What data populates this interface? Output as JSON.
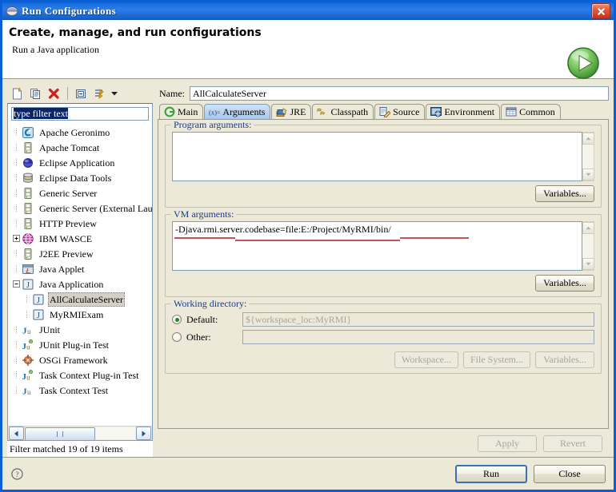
{
  "window": {
    "title": "Run Configurations",
    "title_icon": "run-config-icon",
    "close_label": "✕"
  },
  "header": {
    "heading": "Create, manage, and run configurations",
    "subtitle": "Run a Java application",
    "badge_icon": "green-run-play-icon"
  },
  "toolbar": {
    "items": [
      {
        "name": "new-launch-configuration",
        "icon": "new-document-icon"
      },
      {
        "name": "duplicate-launch-configuration",
        "icon": "copy-document-icon"
      },
      {
        "name": "delete-launch-configuration",
        "icon": "red-x-delete-icon"
      },
      {
        "name": "collapse-all",
        "icon": "collapse-all-icon"
      },
      {
        "name": "filter-launch-configurations",
        "icon": "filter-icon"
      },
      {
        "name": "filter-menu-arrow",
        "icon": "chevron-down-icon"
      }
    ]
  },
  "filter": {
    "value": "type filter text",
    "placeholder": "type filter text",
    "status": "Filter matched 19 of 19 items"
  },
  "tree": {
    "items": [
      {
        "label": "Apache Geronimo",
        "icon": "apache-geronimo-icon",
        "indent": 1,
        "expander": "none",
        "selected": false
      },
      {
        "label": "Apache Tomcat",
        "icon": "server-icon",
        "indent": 1,
        "expander": "none",
        "selected": false
      },
      {
        "label": "Eclipse Application",
        "icon": "eclipse-sphere-icon",
        "indent": 1,
        "expander": "none",
        "selected": false
      },
      {
        "label": "Eclipse Data Tools",
        "icon": "database-icon",
        "indent": 1,
        "expander": "none",
        "selected": false
      },
      {
        "label": "Generic Server",
        "icon": "server-icon",
        "indent": 1,
        "expander": "none",
        "selected": false
      },
      {
        "label": "Generic Server (External Launch)",
        "icon": "server-icon",
        "indent": 1,
        "expander": "none",
        "selected": false
      },
      {
        "label": "HTTP Preview",
        "icon": "server-icon",
        "indent": 1,
        "expander": "none",
        "selected": false
      },
      {
        "label": "IBM WASCE",
        "icon": "wasce-globe-icon",
        "indent": 1,
        "expander": "plus",
        "selected": false
      },
      {
        "label": "J2EE Preview",
        "icon": "server-icon",
        "indent": 1,
        "expander": "none",
        "selected": false
      },
      {
        "label": "Java Applet",
        "icon": "java-applet-icon",
        "indent": 1,
        "expander": "none",
        "selected": false
      },
      {
        "label": "Java Application",
        "icon": "java-application-icon",
        "indent": 1,
        "expander": "minus",
        "selected": false
      },
      {
        "label": "AllCalculateServer",
        "icon": "java-application-icon",
        "indent": 2,
        "expander": "none",
        "selected": true
      },
      {
        "label": "MyRMIExam",
        "icon": "java-application-icon",
        "indent": 2,
        "expander": "none",
        "selected": false
      },
      {
        "label": "JUnit",
        "icon": "junit-icon",
        "indent": 1,
        "expander": "none",
        "selected": false
      },
      {
        "label": "JUnit Plug-in Test",
        "icon": "junit-plugin-icon",
        "indent": 1,
        "expander": "none",
        "selected": false
      },
      {
        "label": "OSGi Framework",
        "icon": "osgi-icon",
        "indent": 1,
        "expander": "none",
        "selected": false
      },
      {
        "label": "Task Context Plug-in Test",
        "icon": "junit-plugin-icon",
        "indent": 1,
        "expander": "none",
        "selected": false
      },
      {
        "label": "Task Context Test",
        "icon": "junit-icon",
        "indent": 1,
        "expander": "none",
        "selected": false
      }
    ]
  },
  "name_field": {
    "label": "Name:",
    "value": "AllCalculateServer"
  },
  "tabs": [
    {
      "label": "Main",
      "icon": "main-green-circle-icon",
      "active": false
    },
    {
      "label": "Arguments",
      "icon": "arguments-xeq-icon",
      "active": true
    },
    {
      "label": "JRE",
      "icon": "jre-books-icon",
      "active": false
    },
    {
      "label": "Classpath",
      "icon": "classpath-folders-icon",
      "active": false
    },
    {
      "label": "Source",
      "icon": "source-pencil-icon",
      "active": false
    },
    {
      "label": "Environment",
      "icon": "environment-icon",
      "active": false
    },
    {
      "label": "Common",
      "icon": "common-table-icon",
      "active": false
    }
  ],
  "program_arguments": {
    "legend": "Program arguments:",
    "value": "",
    "variables_button": "Variables..."
  },
  "vm_arguments": {
    "legend": "VM arguments:",
    "value": "-Djava.rmi.server.codebase=file:E:/Project/MyRMI/bin/",
    "variables_button": "Variables...",
    "annotation_color": "#b31a1a"
  },
  "working_directory": {
    "legend": "Working directory:",
    "default_label": "Default:",
    "default_selected": true,
    "default_value": "${workspace_loc:MyRMI}",
    "other_label": "Other:",
    "other_selected": false,
    "other_value": "",
    "buttons": [
      {
        "label": "Workspace...",
        "enabled": false
      },
      {
        "label": "File System...",
        "enabled": false
      },
      {
        "label": "Variables...",
        "enabled": false
      }
    ]
  },
  "apply_revert": [
    {
      "label": "Apply",
      "enabled": false
    },
    {
      "label": "Revert",
      "enabled": false
    }
  ],
  "footer": {
    "help_icon": "question-mark-help-icon",
    "buttons": [
      {
        "label": "Run",
        "default": true
      },
      {
        "label": "Close",
        "default": false
      }
    ]
  },
  "colors": {
    "title_blue": "#0a5fd4",
    "dialog_bg": "#ece9d8",
    "legend_blue": "#1a3a8f",
    "selection_blue": "#0a246a",
    "annotation_red": "#b31a1a",
    "run_green": "#4faa3f"
  }
}
